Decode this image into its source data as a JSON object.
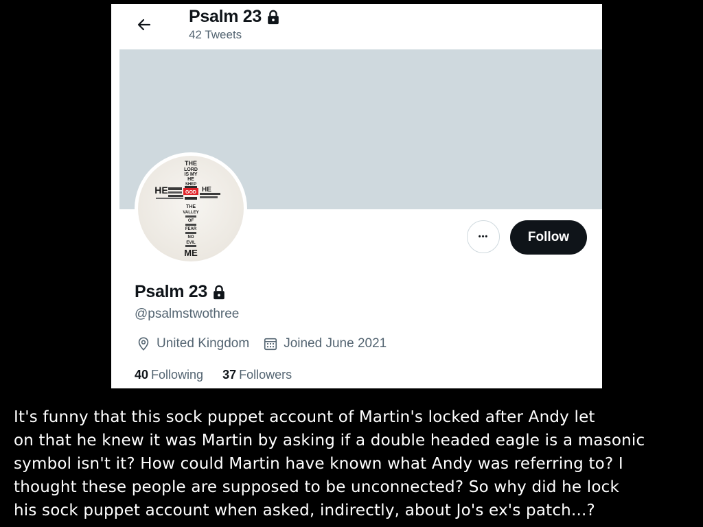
{
  "profile": {
    "display_name": "Psalm 23",
    "tweet_count": "42 Tweets",
    "handle": "@psalmstwothree",
    "location": "United Kingdom",
    "joined": "Joined June 2021",
    "following_count": "40",
    "following_label": "Following",
    "followers_count": "37",
    "followers_label": "Followers",
    "locked": true
  },
  "avatar": {
    "words_top": [
      "THE",
      "LORD",
      "IS MY",
      "HE",
      "SHEP"
    ],
    "left_word": "HE",
    "center_word": "GOD",
    "right_word": "HE",
    "words_bottom": [
      "THE",
      "VALLEY",
      "OF",
      "FEAR",
      "NO",
      "EVIL"
    ],
    "last_word": "ME"
  },
  "buttons": {
    "more_label": "•••",
    "follow_label": "Follow"
  },
  "icons": {
    "back": "arrow-left-icon",
    "lock": "lock-icon",
    "location": "location-pin-icon",
    "calendar": "calendar-icon"
  },
  "caption": {
    "lines": [
      "It's funny that this sock puppet account of Martin's locked after Andy let",
      "on that he knew it was Martin by asking if a double headed eagle is a masonic",
      "symbol isn't it? How could Martin have known what Andy was referring to? I",
      "thought these people are supposed to be unconnected? So why did he lock",
      "his sock puppet account when asked, indirectly, about Jo's ex's patch...?"
    ]
  },
  "colors": {
    "background": "#000000",
    "banner": "#cfd9de",
    "text_primary": "#0f1419",
    "text_secondary": "#536471",
    "follow_button": "#0f1419",
    "avatar_accent": "#e0242a"
  }
}
